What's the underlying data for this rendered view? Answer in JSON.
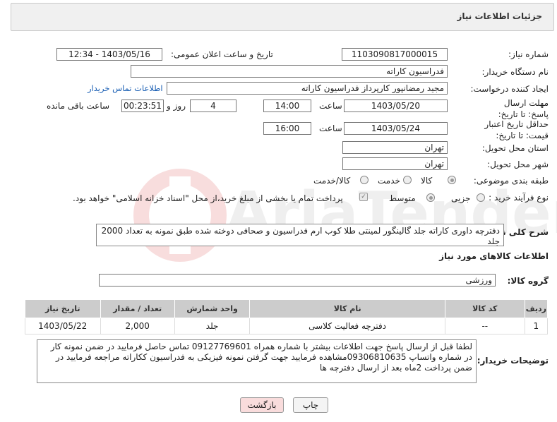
{
  "header": {
    "title": "جزئیات اطلاعات نیاز"
  },
  "fields": {
    "need_number_label": "شماره نیاز:",
    "need_number": "1103090817000015",
    "announce_label": "تاریخ و ساعت اعلان عمومی:",
    "announce_value": "1403/05/16 - 12:34",
    "buyer_org_label": "نام دستگاه خریدار:",
    "buyer_org": "فدراسیون کاراته",
    "requester_label": "ایجاد کننده درخواست:",
    "requester": "مجید رمضانپور کارپرداز فدراسیون کاراته",
    "buyer_contact_link": "اطلاعات تماس خریدار",
    "reply_deadline_label": "مهلت ارسال پاسخ: تا تاریخ:",
    "reply_date": "1403/05/20",
    "time_label": "ساعت",
    "reply_time": "14:00",
    "days_value": "4",
    "days_label": "روز و",
    "remaining_time": "00:23:51",
    "remaining_label": "ساعت باقی مانده",
    "price_validity_label": "حداقل تاریخ اعتبار قیمت: تا تاریخ:",
    "price_date": "1403/05/24",
    "price_time": "16:00",
    "province_label": "استان محل تحویل:",
    "province": "تهران",
    "city_label": "شهر محل تحویل:",
    "city": "تهران",
    "category_label": "طبقه بندی موضوعی:",
    "category_options": [
      "کالا",
      "خدمت",
      "کالا/خدمت"
    ],
    "process_label": "نوع فرآیند خرید :",
    "process_options": [
      "جزیی",
      "متوسط"
    ],
    "payment_note": "پرداخت تمام یا بخشی از مبلغ خرید،از محل \"اسناد خزانه اسلامی\" خواهد بود.",
    "summary_label": "شرح کلی نیاز:",
    "summary": "دفترچه داوری کاراته  جلد گالینگور لمینتی طلا کوب ارم فدراسیون و صحافی دوخته شده طبق نمونه به تعداد 2000 جلد",
    "goods_info_title": "اطلاعات کالاهای مورد نیاز",
    "goods_group_label": "گروه کالا:",
    "goods_group": "ورزشی",
    "buyer_notes_label": "توضیحات خریدار:",
    "buyer_notes": "لطفا قبل از ارسال پاسخ جهت اطلاعات بیشتر با شماره همراه 09127769601 تماس حاصل فرمایید در ضمن نمونه کار در شماره واتساپ 09306810635مشاهده فرمایید جهت گرفتن  نمونه فیزیکی به فدراسیون ککاراته مراجعه فرمایید در ضمن پرداخت 2ماه بعد از ارسال دفترچه ها"
  },
  "table": {
    "headers": [
      "ردیف",
      "کد کالا",
      "نام کالا",
      "واحد شمارش",
      "تعداد / مقدار",
      "تاریخ نیاز"
    ],
    "rows": [
      {
        "row": "1",
        "code": "--",
        "name": "دفترچه فعالیت کلاسی",
        "unit": "جلد",
        "qty": "2,000",
        "date": "1403/05/22"
      }
    ]
  },
  "buttons": {
    "print": "چاپ",
    "back": "بازگشت"
  },
  "watermark_text": "AriaTender.neT",
  "colors": {
    "link": "#1a5fb4",
    "back_button": "#f9dcdc",
    "header_bg": "#f0f0f0"
  }
}
